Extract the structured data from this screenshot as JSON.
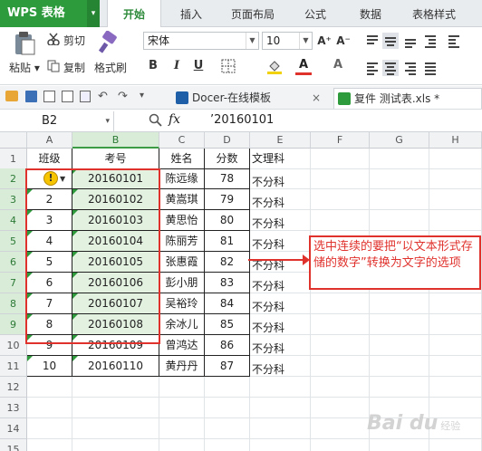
{
  "app": {
    "title": "WPS 表格",
    "menu_arrow": "▾"
  },
  "tabs": [
    "开始",
    "插入",
    "页面布局",
    "公式",
    "数据",
    "表格样式"
  ],
  "ribbon": {
    "paste": "粘贴",
    "cut": "剪切",
    "copy": "复制",
    "format_painter": "格式刷",
    "font_name": "宋体",
    "font_size": "10",
    "grow_font": "A⁺",
    "shrink_font": "A⁻",
    "bold": "B",
    "italic": "I",
    "underline": "U",
    "font_color_letter": "A",
    "clear_letter": "A"
  },
  "doc_tabs": [
    {
      "label": "Docer-在线模板",
      "close": "×"
    },
    {
      "label": "复件 测试表.xls *",
      "close": ""
    }
  ],
  "formula_bar": {
    "cell_ref": "B2",
    "fx": "fx",
    "content": "’20160101"
  },
  "columns": [
    "A",
    "B",
    "C",
    "D",
    "E",
    "F",
    "G",
    "H"
  ],
  "rows": [
    {
      "num": "1",
      "a": "班级",
      "b": "考号",
      "c": "姓名",
      "d": "分数",
      "e": "文理科"
    },
    {
      "num": "2",
      "a": "",
      "b": "20160101",
      "c": "陈远缘",
      "d": "78",
      "e": "不分科"
    },
    {
      "num": "3",
      "a": "2",
      "b": "20160102",
      "c": "黄嵩琪",
      "d": "79",
      "e": "不分科"
    },
    {
      "num": "4",
      "a": "3",
      "b": "20160103",
      "c": "黄思怡",
      "d": "80",
      "e": "不分科"
    },
    {
      "num": "5",
      "a": "4",
      "b": "20160104",
      "c": "陈丽芳",
      "d": "81",
      "e": "不分科"
    },
    {
      "num": "6",
      "a": "5",
      "b": "20160105",
      "c": "张惠霞",
      "d": "82",
      "e": "不分科"
    },
    {
      "num": "7",
      "a": "6",
      "b": "20160106",
      "c": "彭小朋",
      "d": "83",
      "e": "不分科"
    },
    {
      "num": "8",
      "a": "7",
      "b": "20160107",
      "c": "吴裕玲",
      "d": "84",
      "e": "不分科"
    },
    {
      "num": "9",
      "a": "8",
      "b": "20160108",
      "c": "余冰儿",
      "d": "85",
      "e": "不分科"
    },
    {
      "num": "10",
      "a": "9",
      "b": "20160109",
      "c": "曾鸿达",
      "d": "86",
      "e": "不分科"
    },
    {
      "num": "11",
      "a": "10",
      "b": "20160110",
      "c": "黄丹丹",
      "d": "87",
      "e": "不分科"
    },
    {
      "num": "12"
    },
    {
      "num": "13"
    },
    {
      "num": "14"
    },
    {
      "num": "15"
    }
  ],
  "warning_icon": "!",
  "callout": "选中连续的要把“以文本形式存储的数字”转换为文字的选项",
  "watermark": {
    "main": "Bai du",
    "sub": "经验"
  },
  "colors": {
    "brand": "#2d9a3c",
    "selection": "#e3f1e1",
    "annotation": "#e0322d"
  }
}
